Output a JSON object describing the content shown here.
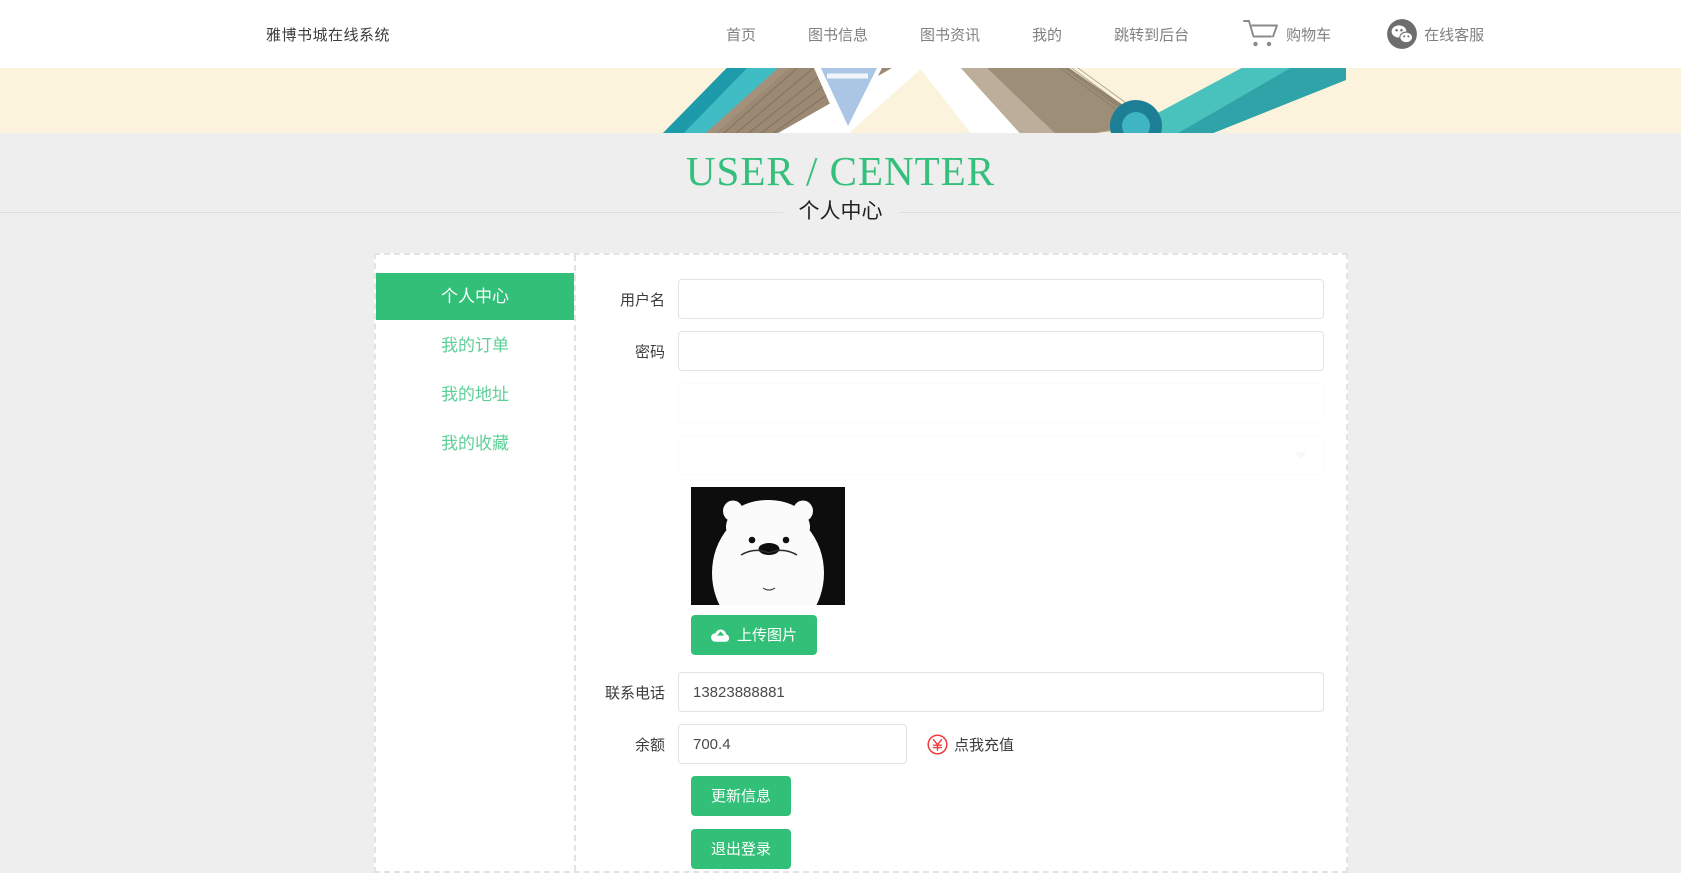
{
  "header": {
    "brand": "雅博书城在线系统",
    "nav": [
      {
        "label": "首页",
        "name": "nav-home"
      },
      {
        "label": "图书信息",
        "name": "nav-book-info"
      },
      {
        "label": "图书资讯",
        "name": "nav-book-news"
      },
      {
        "label": "我的",
        "name": "nav-mine"
      },
      {
        "label": "跳转到后台",
        "name": "nav-backend"
      }
    ],
    "cart": {
      "label": "购物车",
      "icon": "cart-icon"
    },
    "service": {
      "label": "在线客服",
      "icon": "wechat-icon"
    }
  },
  "page": {
    "title_en": "USER / CENTER",
    "title_cn": "个人中心",
    "accent_color": "#32bf78",
    "title_color": "#35bf7d",
    "banner_color": "#fbf3dc",
    "page_bg": "#eeeeee"
  },
  "sidebar": {
    "items": [
      {
        "label": "个人中心",
        "name": "sidebar-item-user-center",
        "active": true
      },
      {
        "label": "我的订单",
        "name": "sidebar-item-my-orders",
        "active": false
      },
      {
        "label": "我的地址",
        "name": "sidebar-item-my-address",
        "active": false
      },
      {
        "label": "我的收藏",
        "name": "sidebar-item-my-favorites",
        "active": false
      }
    ]
  },
  "form": {
    "username": {
      "label": "用户名",
      "value": "",
      "placeholder": ""
    },
    "password": {
      "label": "密码",
      "value": "",
      "placeholder": ""
    },
    "hidden_field_1": {
      "label": "",
      "value": "",
      "placeholder": ""
    },
    "hidden_select": {
      "label": "",
      "value": "",
      "placeholder": ""
    },
    "avatar": {
      "name": "avatar-image",
      "alt": "白熊头像"
    },
    "upload_button": {
      "label": "上传图片",
      "icon": "cloud-upload-icon"
    },
    "phone": {
      "label": "联系电话",
      "value": "13823888881",
      "placeholder": ""
    },
    "balance": {
      "label": "余额",
      "value": "700.4",
      "placeholder": ""
    },
    "recharge": {
      "label": "点我充值",
      "icon": "yen-circle-icon",
      "color": "#f03c3c"
    },
    "update_button": {
      "label": "更新信息"
    },
    "logout_button": {
      "label": "退出登录"
    }
  }
}
